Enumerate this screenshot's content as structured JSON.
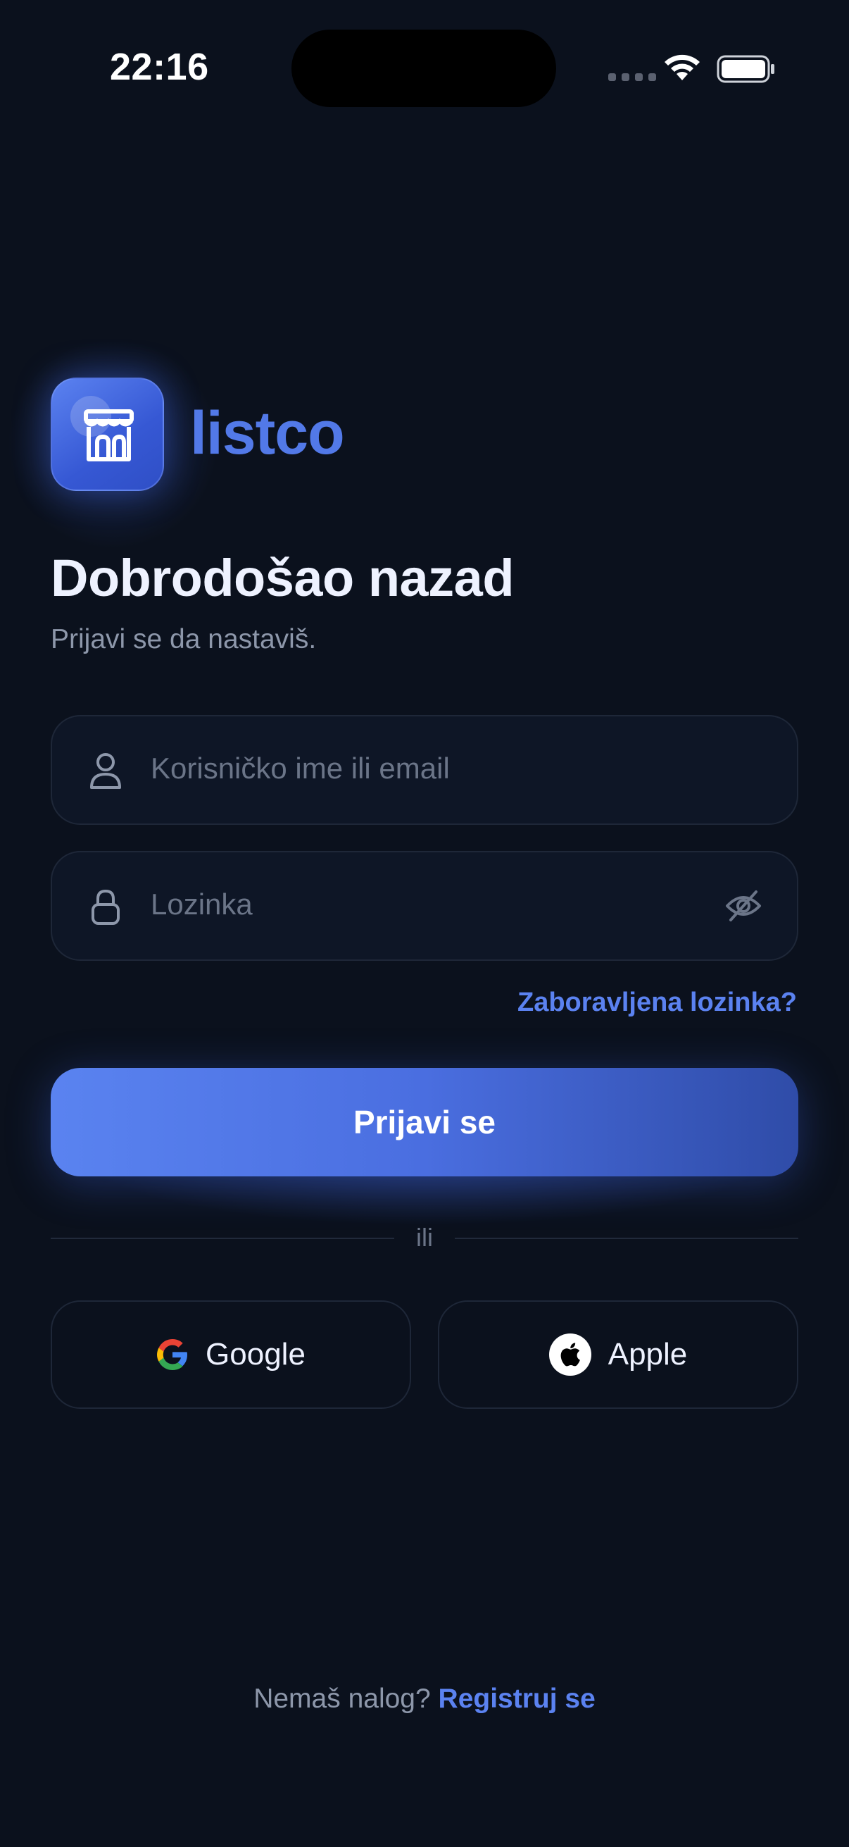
{
  "status_bar": {
    "time": "22:16"
  },
  "brand": {
    "name": "listco",
    "logo_icon": "storefront-icon"
  },
  "header": {
    "title": "Dobrodošao nazad",
    "subtitle": "Prijavi se da nastaviš."
  },
  "form": {
    "username": {
      "placeholder": "Korisničko ime ili email",
      "icon": "user-icon"
    },
    "password": {
      "placeholder": "Lozinka",
      "icon": "lock-icon",
      "toggle_icon": "eye-off-icon"
    },
    "forgot_label": "Zaboravljena lozinka?",
    "submit_label": "Prijavi se"
  },
  "divider_label": "ili",
  "social": {
    "google_label": "Google",
    "apple_label": "Apple"
  },
  "footer": {
    "prompt": "Nemaš nalog?",
    "register_label": "Registruj se"
  },
  "colors": {
    "background": "#0b111d",
    "accent": "#5b82f0",
    "field_bg": "#0e1626",
    "muted_text": "#8d97aa"
  }
}
